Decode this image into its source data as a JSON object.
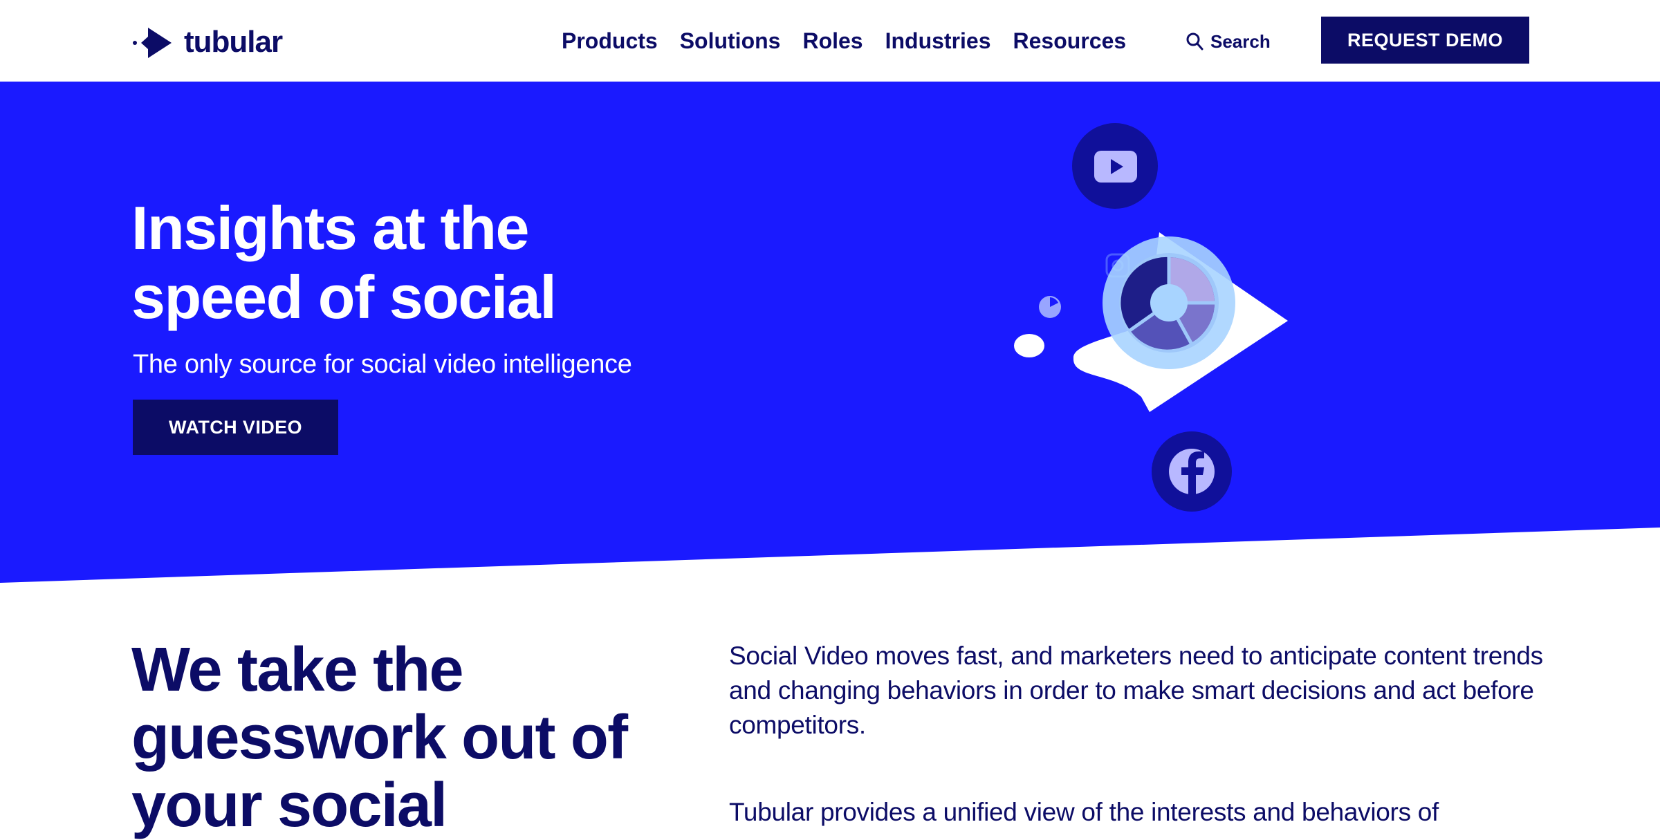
{
  "header": {
    "logo_text": "tubular",
    "nav": [
      "Products",
      "Solutions",
      "Roles",
      "Industries",
      "Resources"
    ],
    "search_label": "Search",
    "demo_button": "REQUEST DEMO"
  },
  "hero": {
    "title_line1": "Insights at the",
    "title_line2": "speed of social",
    "subtitle": "The only source for social video intelligence",
    "watch_button": "WATCH VIDEO"
  },
  "section": {
    "title_line1": "We take the",
    "title_line2": "guesswork out of",
    "title_line3": "your social",
    "paragraph1": "Social Video moves fast, and marketers need to anticipate content trends and changing behaviors in order to make smart decisions and act before competitors.",
    "paragraph2": "Tubular provides a unified view of the interests and behaviors of"
  },
  "icons": [
    "logo-arrow-icon",
    "search-icon",
    "youtube-icon",
    "facebook-icon",
    "instagram-icon",
    "analytics-donut-icon"
  ],
  "colors": {
    "brand_navy": "#0c0c66",
    "hero_blue": "#1a1aff",
    "white": "#ffffff",
    "illustration_light": "#a8d4ff"
  }
}
